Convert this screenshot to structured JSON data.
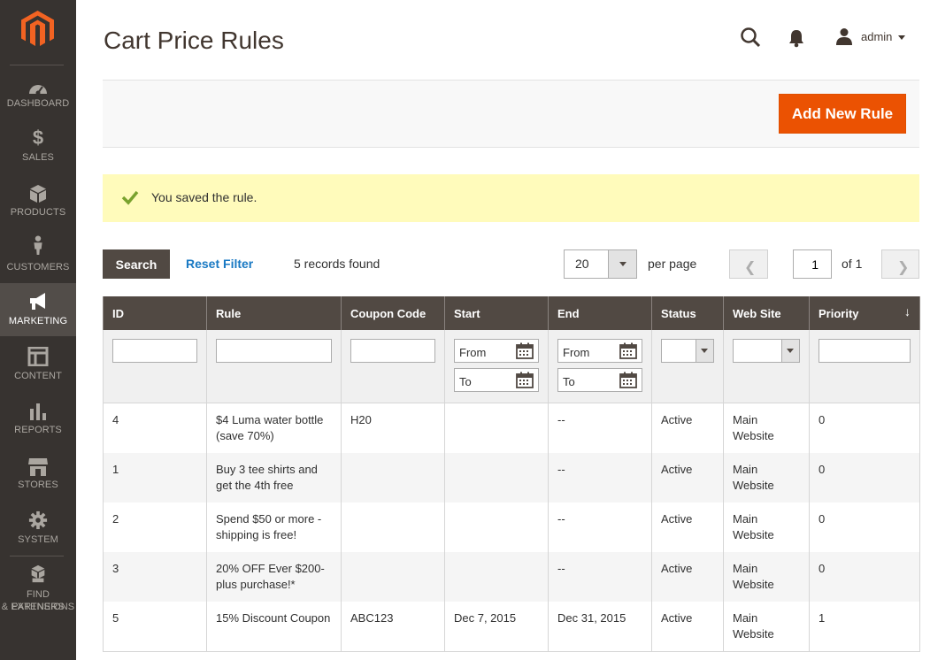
{
  "page": {
    "title": "Cart Price Rules"
  },
  "sidebar": {
    "items": [
      {
        "label": "DASHBOARD",
        "icon": "dashboard-icon"
      },
      {
        "label": "SALES",
        "icon": "dollar-icon"
      },
      {
        "label": "PRODUCTS",
        "icon": "box-icon"
      },
      {
        "label": "CUSTOMERS",
        "icon": "person-icon"
      },
      {
        "label": "MARKETING",
        "icon": "megaphone-icon",
        "active": true
      },
      {
        "label": "CONTENT",
        "icon": "layout-icon"
      },
      {
        "label": "REPORTS",
        "icon": "bar-chart-icon"
      },
      {
        "label": "STORES",
        "icon": "store-icon"
      },
      {
        "label": "SYSTEM",
        "icon": "gear-icon"
      },
      {
        "label": "FIND PARTNERS",
        "label2": "& EXTENSIONS",
        "icon": "cubes-icon"
      }
    ]
  },
  "header": {
    "username": "admin"
  },
  "actions": {
    "add_new_rule": "Add New Rule"
  },
  "message": {
    "text": "You saved the rule."
  },
  "grid_controls": {
    "search": "Search",
    "reset_filter": "Reset Filter",
    "records_found": "5 records found",
    "per_page_value": "20",
    "per_page_label": "per page",
    "current_page": "1",
    "of_pages": "of 1"
  },
  "filters": {
    "from": "From",
    "to": "To"
  },
  "table": {
    "headers": [
      "ID",
      "Rule",
      "Coupon Code",
      "Start",
      "End",
      "Status",
      "Web Site",
      "Priority"
    ],
    "rows": [
      {
        "id": "4",
        "rule": "$4 Luma water bottle (save 70%)",
        "coupon": "H20",
        "start": "",
        "end": "--",
        "status": "Active",
        "website": "Main Website",
        "priority": "0"
      },
      {
        "id": "1",
        "rule": "Buy 3 tee shirts and get the 4th free",
        "coupon": "",
        "start": "",
        "end": "--",
        "status": "Active",
        "website": "Main Website",
        "priority": "0"
      },
      {
        "id": "2",
        "rule": "Spend $50 or more - shipping is free!",
        "coupon": "",
        "start": "",
        "end": "--",
        "status": "Active",
        "website": "Main Website",
        "priority": "0"
      },
      {
        "id": "3",
        "rule": "20% OFF Ever $200-plus purchase!*",
        "coupon": "",
        "start": "",
        "end": "--",
        "status": "Active",
        "website": "Main Website",
        "priority": "0"
      },
      {
        "id": "5",
        "rule": "15% Discount Coupon",
        "coupon": "ABC123",
        "start": "Dec 7, 2015",
        "end": "Dec 31, 2015",
        "status": "Active",
        "website": "Main Website",
        "priority": "1"
      }
    ]
  },
  "colors": {
    "accent": "#eb5202",
    "sidebar_bg": "#373330",
    "header_bg": "#514943",
    "message_bg": "#fffbbb",
    "link": "#1979c3"
  }
}
